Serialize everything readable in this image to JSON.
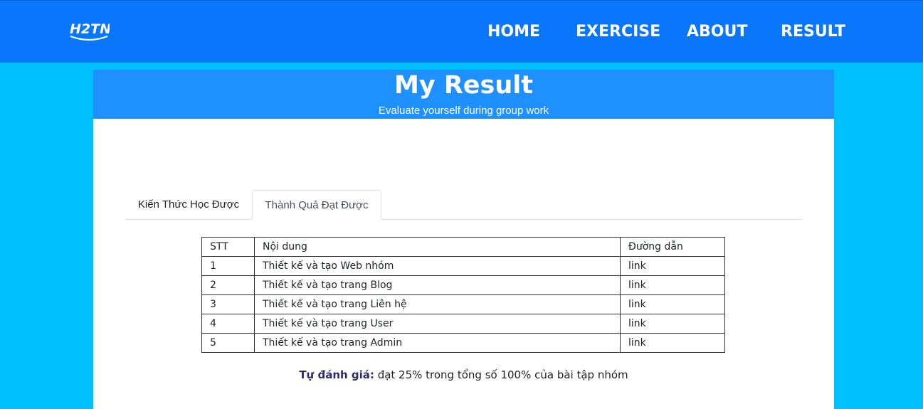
{
  "navbar": {
    "logo_alt": "H2TN",
    "links": [
      {
        "label": "HOME"
      },
      {
        "label": "EXERCISE"
      },
      {
        "label": "ABOUT"
      },
      {
        "label": "RESULT"
      }
    ]
  },
  "hero": {
    "title": "My Result",
    "subtitle": "Evaluate yourself during group work"
  },
  "tabs": [
    {
      "label": "Kiến Thức Học Được",
      "active": false
    },
    {
      "label": "Thành Quả Đạt Được",
      "active": true
    }
  ],
  "table": {
    "headers": [
      "STT",
      "Nội dung",
      "Đường dẫn"
    ],
    "rows": [
      [
        "1",
        "Thiết kế và tạo Web nhóm",
        "link"
      ],
      [
        "2",
        "Thiết kế và tạo trang Blog",
        "link"
      ],
      [
        "3",
        "Thiết kế và tạo trang Liên hệ",
        "link"
      ],
      [
        "4",
        "Thiết kế và tạo trang User",
        "link"
      ],
      [
        "5",
        "Thiết kế và tạo trang Admin",
        "link"
      ]
    ]
  },
  "evaluation": {
    "label": "Tự đánh giá:",
    "text": "đạt 25% trong tổng số 100% của bài tập nhóm"
  },
  "colors": {
    "navbar_bg": "#0a76fc",
    "page_bg": "#00bfff",
    "hero_bg": "#1e90ff"
  }
}
